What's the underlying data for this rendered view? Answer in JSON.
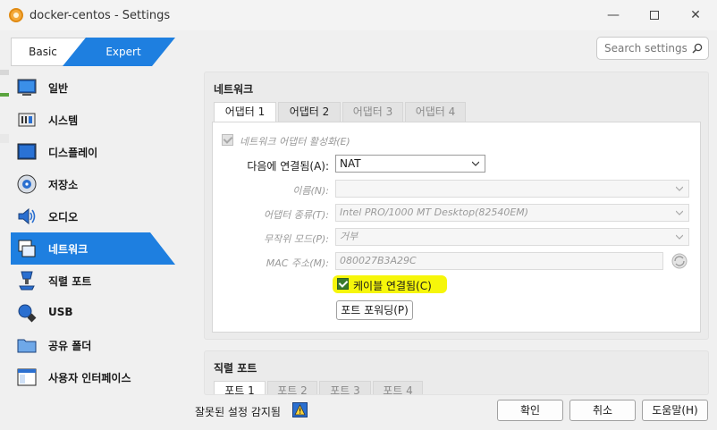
{
  "window": {
    "title": "docker-centos - Settings"
  },
  "mode": {
    "basic_label": "Basic",
    "expert_label": "Expert"
  },
  "search": {
    "placeholder": "Search settings"
  },
  "sidebar": {
    "items": [
      {
        "label": "일반",
        "icon": "monitor-icon"
      },
      {
        "label": "시스템",
        "icon": "chip-icon"
      },
      {
        "label": "디스플레이",
        "icon": "display-icon"
      },
      {
        "label": "저장소",
        "icon": "disk-icon"
      },
      {
        "label": "오디오",
        "icon": "speaker-icon"
      },
      {
        "label": "네트워크",
        "icon": "network-icon"
      },
      {
        "label": "직렬 포트",
        "icon": "serial-port-icon"
      },
      {
        "label": "USB",
        "icon": "usb-icon"
      },
      {
        "label": "공유 폴더",
        "icon": "folder-icon"
      },
      {
        "label": "사용자 인터페이스",
        "icon": "ui-window-icon"
      }
    ],
    "active_index": 5
  },
  "network": {
    "title": "네트워크",
    "tabs": [
      "어댑터 1",
      "어댑터 2",
      "어댑터 3",
      "어댑터 4"
    ],
    "enable_adapter_label": "네트워크 어댑터 활성화(E)",
    "attached_to_label": "다음에 연결됨(A):",
    "attached_to_value": "NAT",
    "name_label": "이름(N):",
    "adapter_type_label": "어댑터 종류(T):",
    "adapter_type_value": "Intel PRO/1000 MT Desktop(82540EM)",
    "promisc_label": "무작위 모드(P):",
    "promisc_value": "거부",
    "mac_label": "MAC 주소(M):",
    "mac_value": "080027B3A29C",
    "cable_connected_label": "케이블 연결됨(C)",
    "port_forwarding_label": "포트 포워딩(P)"
  },
  "serial": {
    "title": "직렬 포트",
    "tabs": [
      "포트 1",
      "포트 2",
      "포트 3",
      "포트 4"
    ]
  },
  "footer": {
    "warning_text": "잘못된 설정 감지됨",
    "ok_label": "확인",
    "cancel_label": "취소",
    "help_label": "도움말(H)"
  },
  "colors": {
    "accent": "#1e7fe0",
    "highlight": "#f6f60a",
    "checkbox_green": "#3a7a2a"
  }
}
